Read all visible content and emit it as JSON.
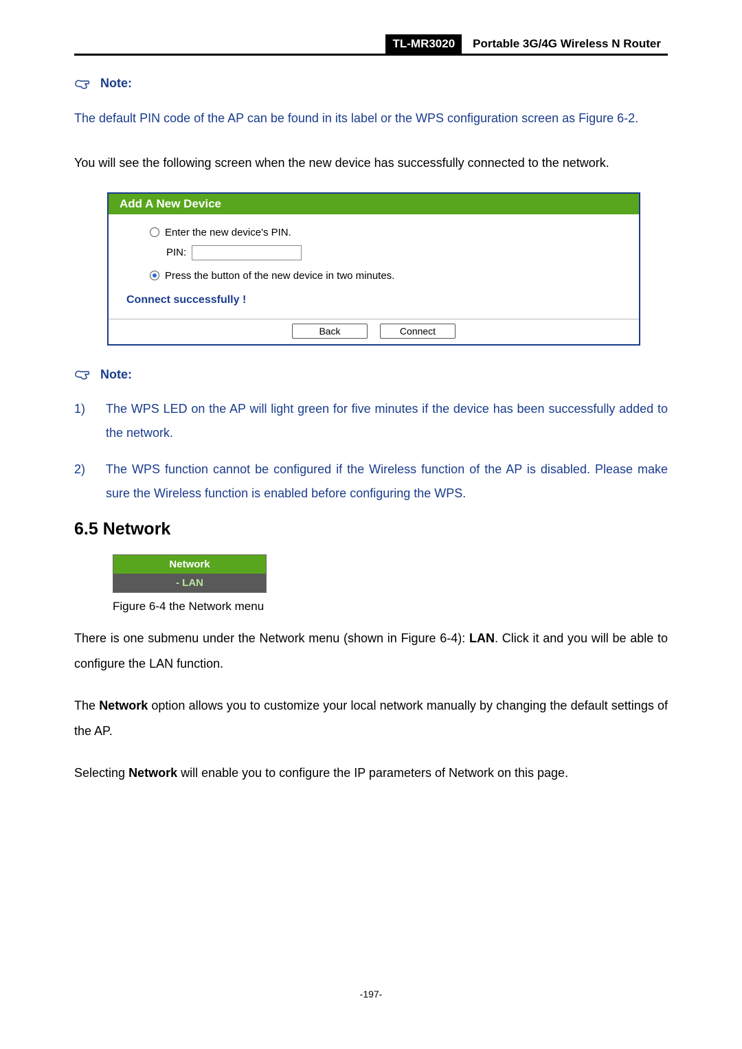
{
  "header": {
    "model": "TL-MR3020",
    "title": "Portable 3G/4G Wireless N Router"
  },
  "note1": {
    "label": "Note:",
    "text": "The default PIN code of the AP can be found in its label or the WPS configuration screen as Figure 6-2."
  },
  "intro": "You will see the following screen when the new device has successfully connected to the network.",
  "panel": {
    "title": "Add A New Device",
    "opt1": "Enter the new device's PIN.",
    "pin_label": "PIN:",
    "pin_value": "",
    "opt2": "Press the button of the new device in two minutes.",
    "status": "Connect successfully !",
    "btn_back": "Back",
    "btn_connect": "Connect"
  },
  "note2": {
    "label": "Note:",
    "items": [
      {
        "num": "1)",
        "text": "The WPS LED on the AP will light green for five minutes if the device has been successfully added to the network."
      },
      {
        "num": "2)",
        "text": "The WPS function cannot be configured if the Wireless function of the AP is disabled. Please make sure the Wireless function is enabled before configuring the WPS."
      }
    ]
  },
  "section": {
    "heading": "6.5  Network",
    "menu_head": "Network",
    "menu_item": "- LAN",
    "caption": "Figure 6-4    the Network menu"
  },
  "para1_pre": "There is one submenu under the Network menu (shown in Figure 6-4): ",
  "para1_bold": "LAN",
  "para1_post": ". Click it and you will be able to configure the LAN function.",
  "para2_pre": "The ",
  "para2_bold": "Network",
  "para2_post": " option allows you to customize your local network manually by changing the default settings of the AP.",
  "para3_pre": "Selecting ",
  "para3_bold": "Network",
  "para3_post": " will enable you to configure the IP parameters of Network on this page.",
  "page_number": "-197-"
}
